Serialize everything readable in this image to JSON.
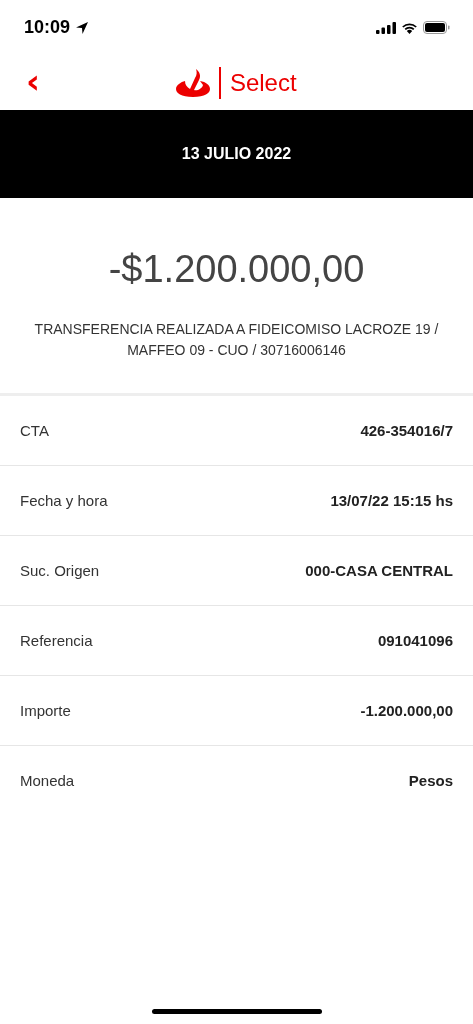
{
  "status_bar": {
    "time": "10:09"
  },
  "header": {
    "back": "‹",
    "brand": "Select"
  },
  "date_banner": "13 JULIO 2022",
  "amount": "-$1.200.000,00",
  "description": "TRANSFERENCIA REALIZADA A FIDEICOMISO LACROZE 19 / MAFFEO 09 - CUO / 30716006146",
  "details": [
    {
      "label": "CTA",
      "value": "426-354016/7"
    },
    {
      "label": "Fecha y hora",
      "value": "13/07/22 15:15 hs"
    },
    {
      "label": "Suc. Origen",
      "value": "000-CASA CENTRAL"
    },
    {
      "label": "Referencia",
      "value": "091041096"
    },
    {
      "label": "Importe",
      "value": "-1.200.000,00"
    },
    {
      "label": "Moneda",
      "value": "Pesos"
    }
  ]
}
